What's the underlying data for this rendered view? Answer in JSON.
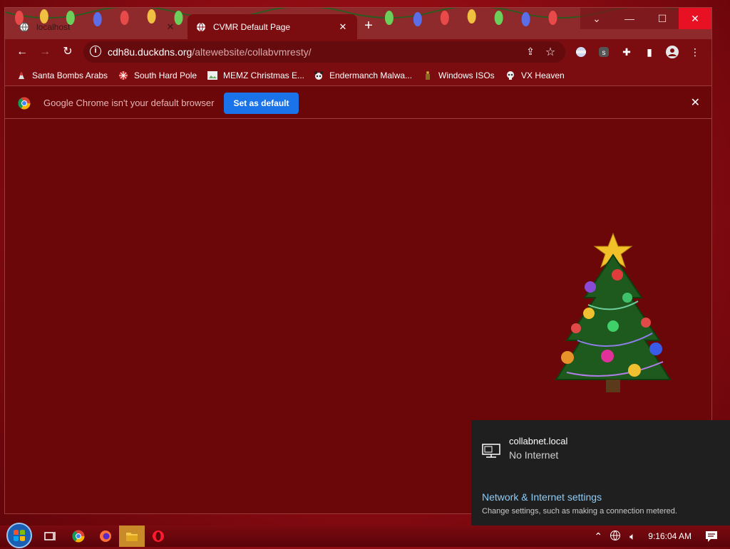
{
  "browser": {
    "tabs": [
      {
        "title": "localhost",
        "active": false
      },
      {
        "title": "CVMR Default Page",
        "active": true
      }
    ],
    "address_bar": {
      "host": "cdh8u.duckdns.org",
      "path": "/altewebsite/collabvmresty/"
    },
    "bookmarks": [
      {
        "label": "Santa Bombs Arabs",
        "icon": "santa-icon"
      },
      {
        "label": "South Hard Pole",
        "icon": "snowflake-icon"
      },
      {
        "label": "MEMZ Christmas E...",
        "icon": "image-icon"
      },
      {
        "label": "Endermanch Malwa...",
        "icon": "panda-icon"
      },
      {
        "label": "Windows ISOs",
        "icon": "figure-icon"
      },
      {
        "label": "VX Heaven",
        "icon": "skull-icon"
      }
    ],
    "infobar": {
      "message": "Google Chrome isn't your default browser",
      "button": "Set as default"
    },
    "theme_color": "#7b0c10",
    "content_color": "#6b0709"
  },
  "network_flyout": {
    "network_name": "collabnet.local",
    "status": "No Internet",
    "settings_link": "Network & Internet settings",
    "settings_hint": "Change settings, such as making a connection metered."
  },
  "taskbar": {
    "clock": "9:16:04 AM",
    "apps": [
      "task-view-icon",
      "chrome-icon",
      "firefox-icon",
      "file-explorer-icon",
      "opera-icon"
    ]
  },
  "accent_colors": {
    "set_default_button": "#1a73e8",
    "close_button": "#e81123",
    "link": "#8ecdf7"
  }
}
